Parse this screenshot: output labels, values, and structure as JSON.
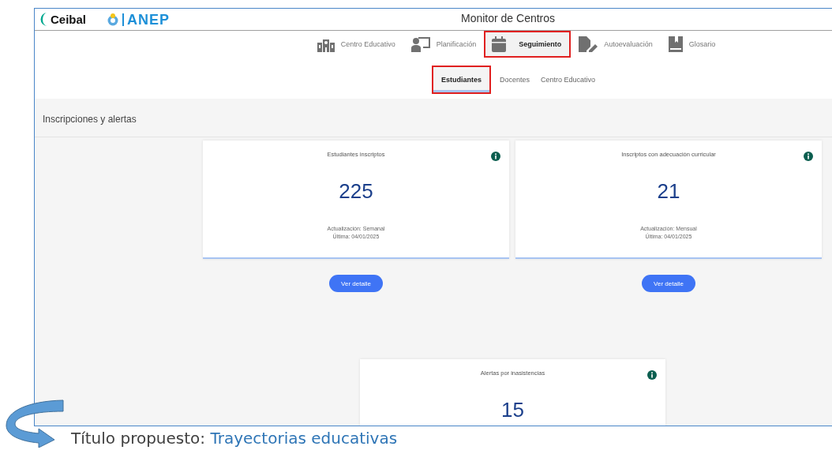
{
  "header": {
    "brand": "Ceibal",
    "agency": "ANEP",
    "title": "Monitor de Centros"
  },
  "nav": [
    {
      "label": "Centro Educativo",
      "kind": "school",
      "selected": false,
      "highlighted": false
    },
    {
      "label": "Planificación",
      "kind": "presenter",
      "selected": false,
      "highlighted": false
    },
    {
      "label": "Seguimiento",
      "kind": "calendar",
      "selected": true,
      "highlighted": true
    },
    {
      "label": "Autoevaluación",
      "kind": "file",
      "selected": false,
      "highlighted": false
    },
    {
      "label": "Glosario",
      "kind": "book",
      "selected": false,
      "highlighted": false
    }
  ],
  "subtabs": [
    {
      "label": "Estudiantes",
      "selected": true,
      "highlighted": true
    },
    {
      "label": "Docentes",
      "selected": false,
      "highlighted": false
    },
    {
      "label": "Centro Educativo",
      "selected": false,
      "highlighted": false
    }
  ],
  "section_title": "Inscripciones y alertas",
  "cards": [
    {
      "title": "Estudiantes inscriptos",
      "value": "225",
      "update": "Actualización: Semanal",
      "last": "Última: 04/01/2025",
      "button": "Ver detalle"
    },
    {
      "title": "Inscriptos con adecuación curricular",
      "value": "21",
      "update": "Actualización: Mensual",
      "last": "Última: 04/01/2025",
      "button": "Ver detalle"
    },
    {
      "title": "Alertas por inasistencias",
      "value": "15"
    }
  ],
  "annotation": {
    "label": "Título propuesto:",
    "proposal": "Trayectorias educativas"
  }
}
